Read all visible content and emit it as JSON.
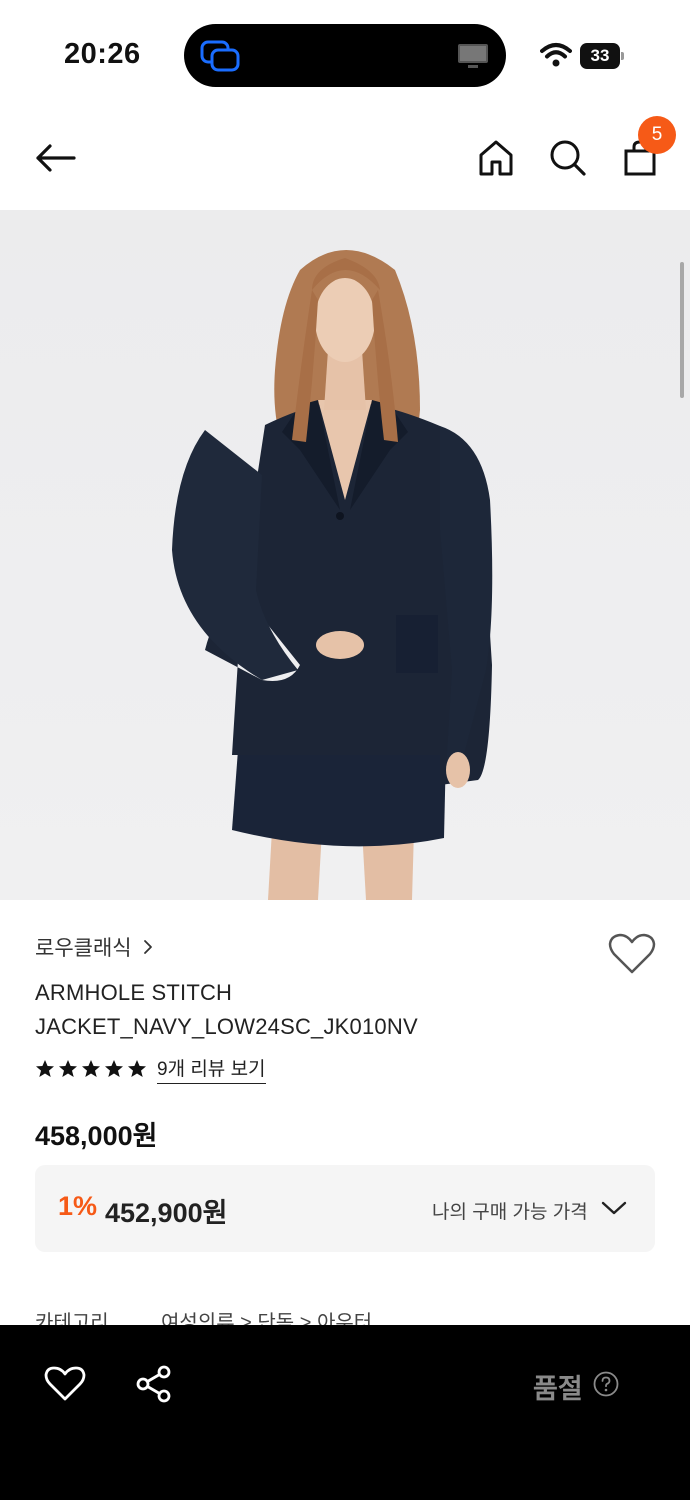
{
  "status_bar": {
    "time": "20:26",
    "battery": "33"
  },
  "header": {
    "cart_count": "5"
  },
  "product": {
    "brand": "로우클래식",
    "title_line1": "ARMHOLE STITCH",
    "title_line2": "JACKET_NAVY_LOW24SC_JK010NV",
    "rating_stars": 5,
    "review_link": "9개 리뷰 보기",
    "price": "458,000원",
    "discount_rate": "1%",
    "discount_price": "452,900원",
    "my_price_label": "나의 구매 가능 가격"
  },
  "category": {
    "label": "카테고리",
    "path": "여성의류 > 단독 > 아우터"
  },
  "bottom_bar": {
    "status": "품절"
  },
  "colors": {
    "accent": "#f65a17",
    "bottom_bar_bg": "#000000",
    "soldout_text": "#8a8a8a"
  }
}
